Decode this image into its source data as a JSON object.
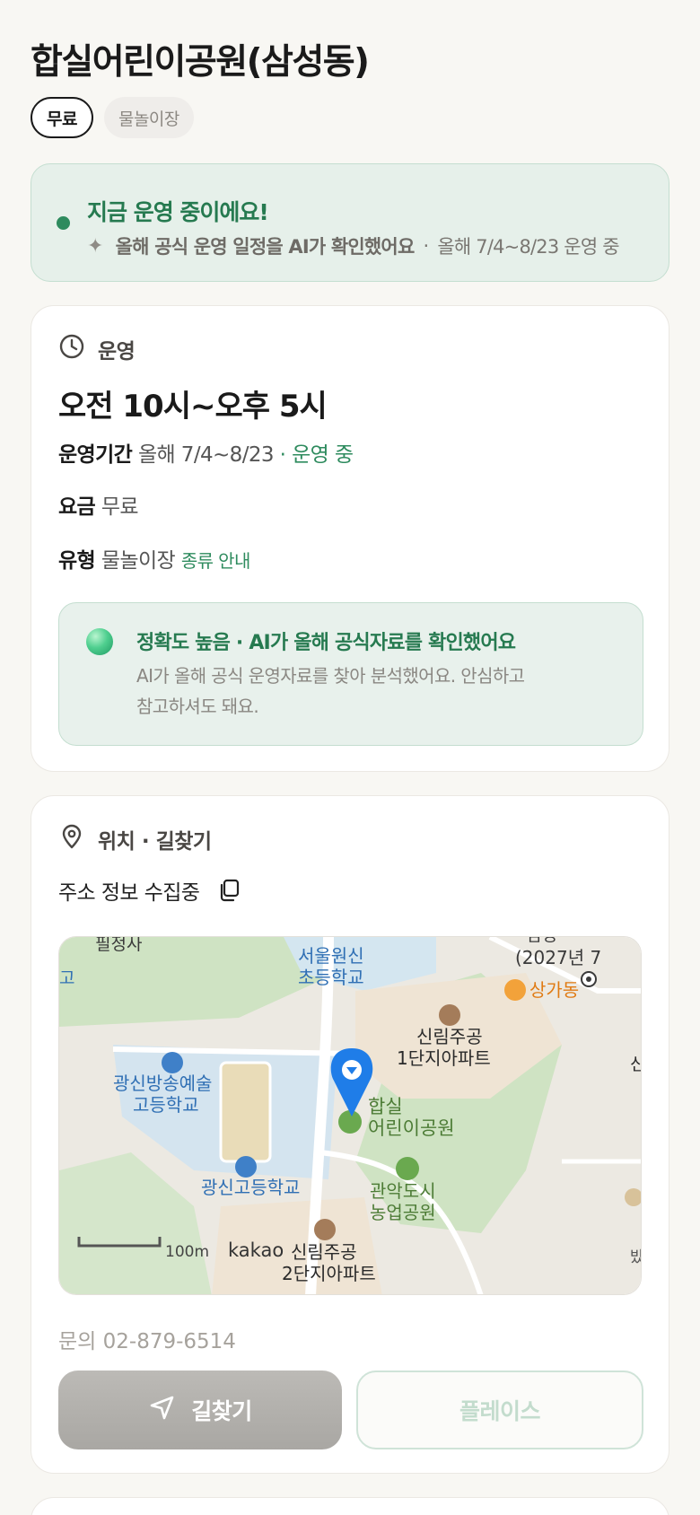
{
  "place": {
    "title": "합실어린이공원(삼성동)",
    "tags": [
      "무료",
      "물놀이장"
    ]
  },
  "status": {
    "title": "지금 운영 중이에요!",
    "ai_note": "올해 공식 운영 일정을 AI가 확인했어요",
    "separator": "·",
    "period_note": "올해 7/4~8/23 운영 중",
    "accent_color": "#2e8b5e"
  },
  "operation": {
    "section_label": "운영",
    "hours": "오전 10시~오후 5시",
    "period_label": "운영기간",
    "period_value": "올해 7/4~8/23",
    "period_status": "· 운영 중",
    "fee_label": "요금",
    "fee_value": "무료",
    "type_label": "유형",
    "type_value": "물놀이장",
    "type_link": "종류 안내",
    "ai_box": {
      "title": "정확도 높음 · AI가 올해 공식자료를 확인했어요",
      "desc_line1": "AI가 올해 공식 운영자료를 찾아 분석했어요. 안심하고",
      "desc_line2": "참고하셔도 돼요."
    }
  },
  "location": {
    "section_label": "위치 · 길찾기",
    "address": "주소 정보 수집중",
    "map": {
      "labels": {
        "top_left_cut": "필정사",
        "left_edge": "고",
        "school1_l1": "서울원신",
        "school1_l2": "초등학교",
        "topright_cut": "(2027년 7",
        "topright_cut2": "임청",
        "sanggadong": "상가동",
        "apt1_l1": "신림주공",
        "apt1_l2": "1단지아파트",
        "right_cut": "신",
        "school2_l1": "광신방송예술",
        "school2_l2": "고등학교",
        "park_l1": "합실",
        "park_l2": "어린이공원",
        "school3": "광신고등학교",
        "farm_l1": "관악도시",
        "farm_l2": "농업공원",
        "apt2_l1": "신림주공",
        "apt2_l2": "2단지아파트",
        "scale": "100m",
        "brand": "kakao",
        "bottom_right_cut": "밨"
      }
    },
    "phone": "문의 02-879-6514",
    "directions_button": "길찾기",
    "places_button": "플레이스"
  }
}
